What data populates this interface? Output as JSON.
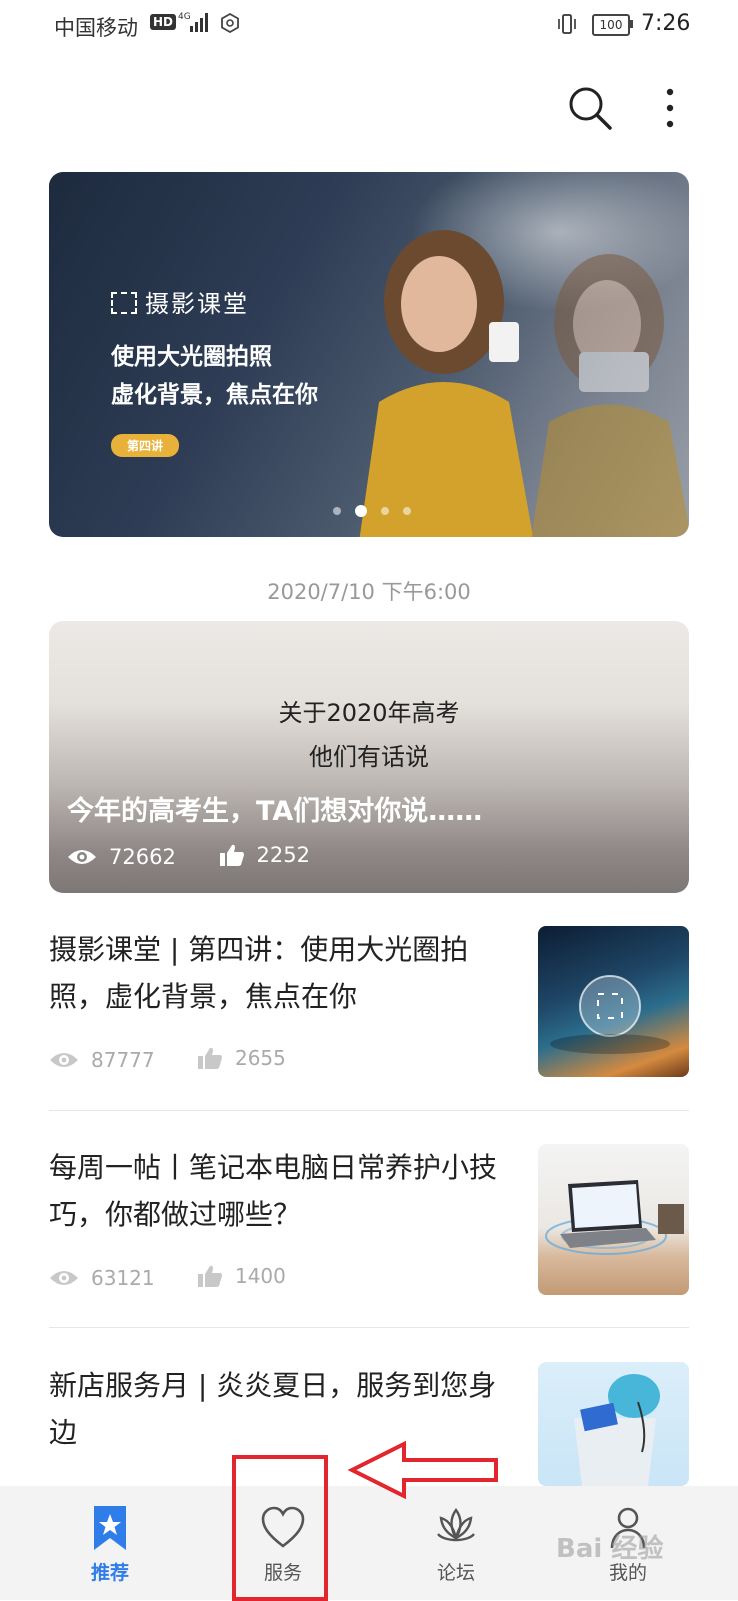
{
  "status_bar": {
    "carrier": "中国移动",
    "hd": "HD",
    "network": "4G",
    "battery": "100",
    "time": "7:26"
  },
  "banner": {
    "brand": "摄影课堂",
    "title_line1": "使用大光圈拍照",
    "title_line2": "虚化背景，焦点在你",
    "tag": "第四讲",
    "active_slide": 2,
    "slides": 4
  },
  "date_label": "2020/7/10 下午6:00",
  "featured": {
    "line1": "关于2020年高考",
    "line2": "他们有话说",
    "title": "今年的高考生，TA们想对你说……",
    "views": "72662",
    "likes": "2252"
  },
  "articles": [
    {
      "title": "摄影课堂 | 第四讲：使用大光圈拍照，虚化背景，焦点在你",
      "views": "87777",
      "likes": "2655"
    },
    {
      "title": "每周一帖丨笔记本电脑日常养护小技巧，你都做过哪些？",
      "views": "63121",
      "likes": "1400"
    },
    {
      "title": "新店服务月 | 炎炎夏日，服务到您身边",
      "views": "",
      "likes": ""
    }
  ],
  "nav": {
    "items": [
      {
        "label": "推荐",
        "icon": "bookmark-star-icon",
        "active": true
      },
      {
        "label": "服务",
        "icon": "heart-icon",
        "active": false
      },
      {
        "label": "论坛",
        "icon": "lotus-icon",
        "active": false
      },
      {
        "label": "我的",
        "icon": "person-icon",
        "active": false
      }
    ]
  },
  "watermark": "Bai 经验",
  "colors": {
    "accent": "#2e7de9",
    "annotation": "#e3262e",
    "tag": "#e8b23a"
  }
}
